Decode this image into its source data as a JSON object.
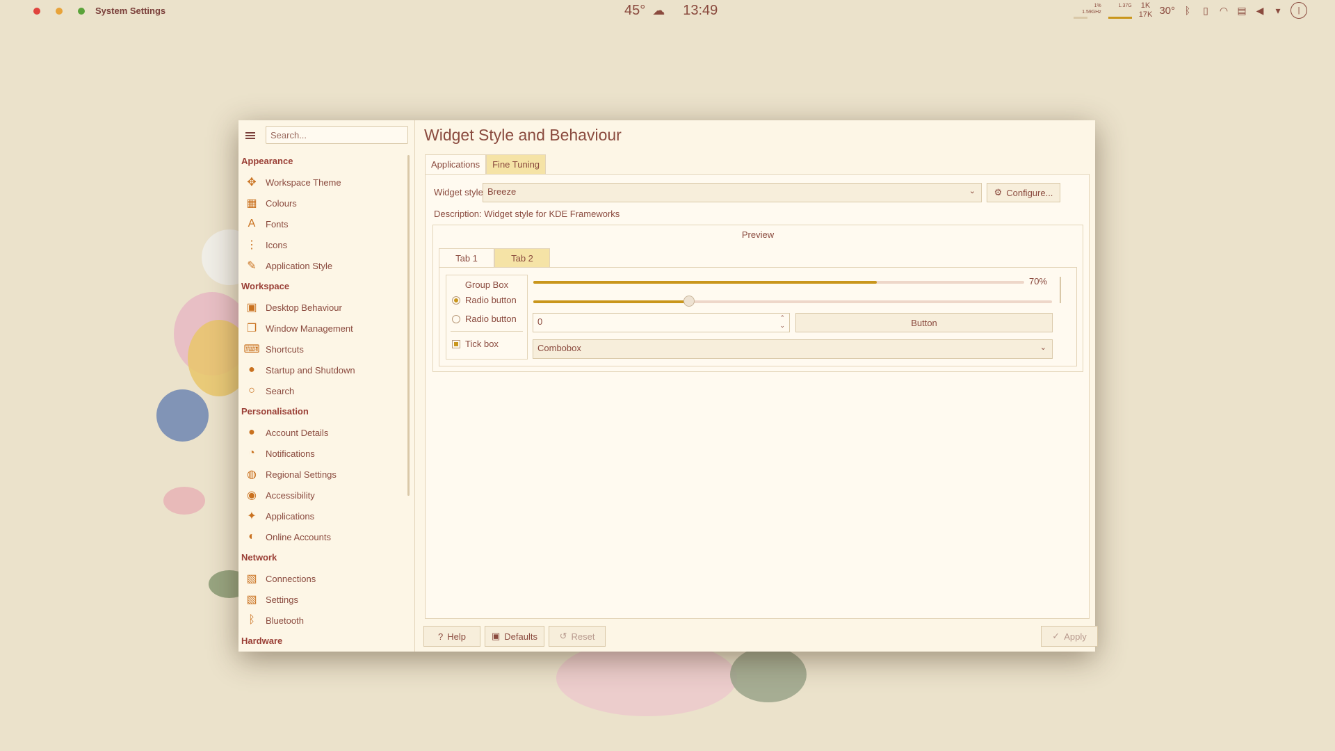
{
  "topbar": {
    "app_title": "System Settings",
    "temperature": "45°",
    "time": "13:49",
    "cpu_pct": "1%",
    "cpu_freq": "1.59GHz",
    "mem": "1.37G",
    "net_up": "1K",
    "net_down": "17K",
    "cpu_temp": "30°",
    "weather_icon": "snow-cloud-icon",
    "traffic_light_colors": [
      "#e0443e",
      "#e8a33a",
      "#5aa33a"
    ]
  },
  "sidebar": {
    "search_placeholder": "Search...",
    "sections": [
      {
        "title": "Appearance",
        "items": [
          "Workspace Theme",
          "Colours",
          "Fonts",
          "Icons",
          "Application Style"
        ]
      },
      {
        "title": "Workspace",
        "items": [
          "Desktop Behaviour",
          "Window Management",
          "Shortcuts",
          "Startup and Shutdown",
          "Search"
        ]
      },
      {
        "title": "Personalisation",
        "items": [
          "Account Details",
          "Notifications",
          "Regional Settings",
          "Accessibility",
          "Applications",
          "Online Accounts"
        ]
      },
      {
        "title": "Network",
        "items": [
          "Connections",
          "Settings",
          "Bluetooth"
        ]
      },
      {
        "title": "Hardware",
        "items": []
      }
    ]
  },
  "main": {
    "title": "Widget Style and Behaviour",
    "tabs": [
      {
        "label": "Applications"
      },
      {
        "label": "Fine Tuning"
      }
    ],
    "widget_style_label": "Widget style:",
    "widget_style_value": "Breeze",
    "configure_label": "Configure...",
    "description": "Description: Widget style for KDE Frameworks",
    "preview": {
      "title": "Preview",
      "tabs": [
        {
          "label": "Tab 1"
        },
        {
          "label": "Tab 2"
        }
      ],
      "group_box_title": "Group Box",
      "radio1": "Radio button",
      "radio2": "Radio button",
      "tickbox": "Tick box",
      "progress_value": 0.7,
      "progress_label": "70%",
      "slider_value": 0.3,
      "spin_value": "0",
      "button_label": "Button",
      "combobox_value": "Combobox"
    }
  },
  "footer": {
    "help": "Help",
    "defaults": "Defaults",
    "reset": "Reset",
    "apply": "Apply"
  },
  "colors": {
    "accent": "#c9961c",
    "text": "#8a4a3e",
    "background": "#ebe2cb"
  }
}
